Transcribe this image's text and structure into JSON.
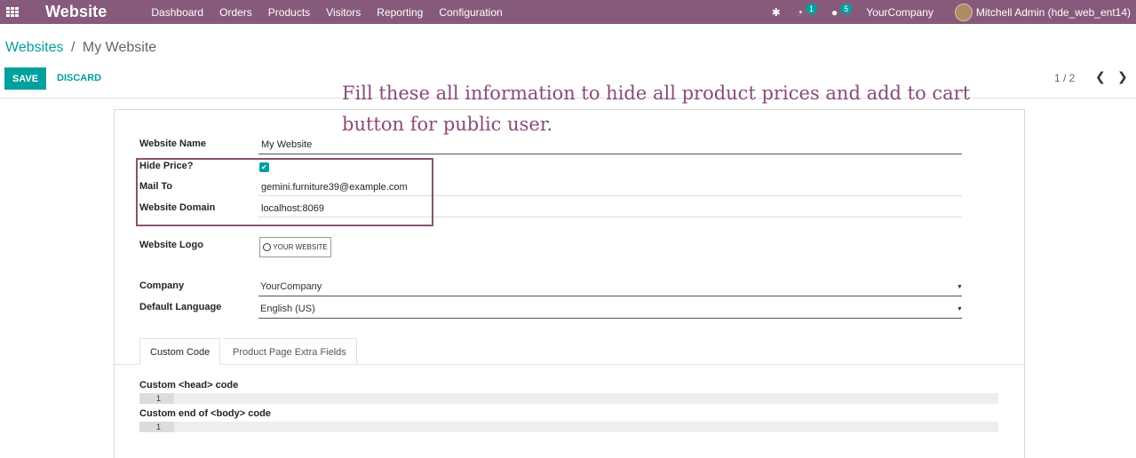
{
  "navbar": {
    "app_title": "Website",
    "menu": [
      "Dashboard",
      "Orders",
      "Products",
      "Visitors",
      "Reporting",
      "Configuration"
    ],
    "activity_count": "1",
    "messages_count": "5",
    "company": "YourCompany",
    "user": "Mitchell Admin (hde_web_ent14)",
    "accent_color": "#875a7b"
  },
  "breadcrumb": {
    "parent": "Websites",
    "separator": "/",
    "current": "My Website"
  },
  "actions": {
    "save_label": "SAVE",
    "discard_label": "DISCARD"
  },
  "pager": {
    "value": "1 / 2",
    "prev_icon": "chevron-left-icon",
    "next_icon": "chevron-right-icon"
  },
  "annotation": {
    "text": "Fill these all information to hide all product prices and add to cart button for public user."
  },
  "form": {
    "website_name": {
      "label": "Website Name",
      "value": "My Website"
    },
    "hide_price": {
      "label": "Hide Price?",
      "checked": true
    },
    "mail_to": {
      "label": "Mail To",
      "value": "gemini.furniture39@example.com"
    },
    "website_domain": {
      "label": "Website Domain",
      "value": "localhost:8069"
    },
    "website_logo": {
      "label": "Website Logo",
      "value": "YOUR WEBSITE"
    },
    "company": {
      "label": "Company",
      "value": "YourCompany"
    },
    "default_language": {
      "label": "Default Language",
      "value": "English (US)"
    }
  },
  "tabs": [
    {
      "label": "Custom Code",
      "active": true
    },
    {
      "label": "Product Page Extra Fields",
      "active": false
    }
  ],
  "custom_code": {
    "head_label": "Custom <head> code",
    "head_line_number": "1",
    "body_label": "Custom end of <body> code",
    "body_line_number": "1"
  },
  "colors": {
    "primary": "#00a09d",
    "annotation": "#8a4a78"
  }
}
